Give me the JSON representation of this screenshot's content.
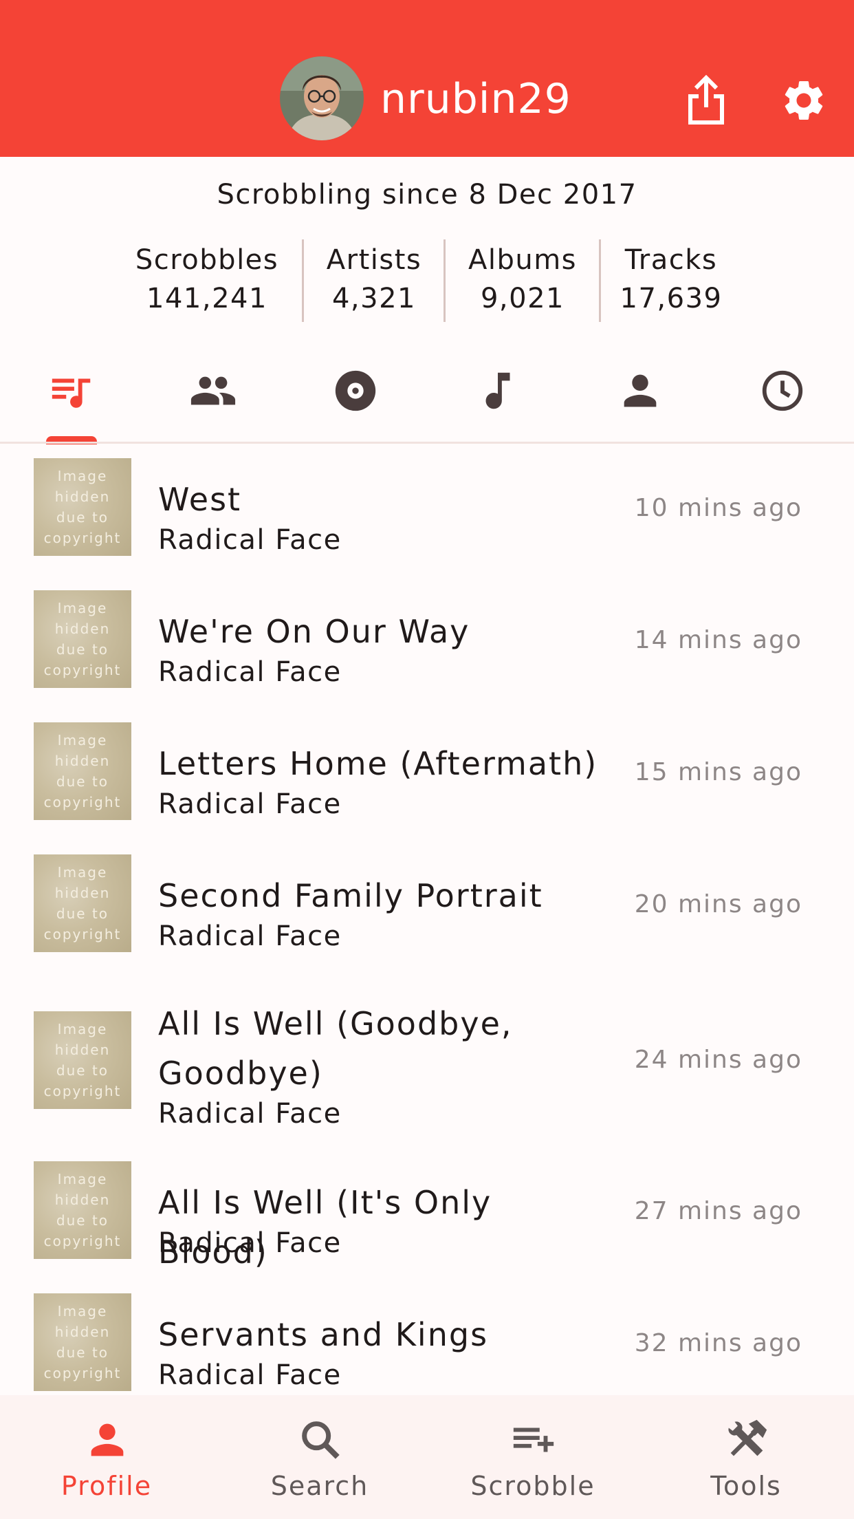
{
  "header": {
    "username": "nrubin29",
    "background_color": "#f44336",
    "share_icon": "share-icon",
    "settings_icon": "gear-icon"
  },
  "profile": {
    "scrobbling_since": "Scrobbling since 8 Dec 2017",
    "stats": [
      {
        "label": "Scrobbles",
        "value": "141,241"
      },
      {
        "label": "Artists",
        "value": "4,321"
      },
      {
        "label": "Albums",
        "value": "9,021"
      },
      {
        "label": "Tracks",
        "value": "17,639"
      }
    ]
  },
  "tabs": [
    {
      "icon": "recent-scrobbles-icon",
      "selected": true
    },
    {
      "icon": "friends-icon",
      "selected": false
    },
    {
      "icon": "album-icon",
      "selected": false
    },
    {
      "icon": "track-icon",
      "selected": false
    },
    {
      "icon": "artist-icon",
      "selected": false
    },
    {
      "icon": "clock-icon",
      "selected": false
    }
  ],
  "placeholder_image_text": "Image\nhidden\ndue to\ncopyright",
  "scrobbles": [
    {
      "title": "West",
      "artist": "Radical Face",
      "time": "10 mins ago"
    },
    {
      "title": "We're On Our Way",
      "artist": "Radical Face",
      "time": "14 mins ago"
    },
    {
      "title": "Letters Home (Aftermath)",
      "artist": "Radical Face",
      "time": "15 mins ago"
    },
    {
      "title": "Second Family Portrait",
      "artist": "Radical Face",
      "time": "20 mins ago"
    },
    {
      "title": "All Is Well (Goodbye, Goodbye)",
      "artist": "Radical Face",
      "time": "24 mins ago"
    },
    {
      "title": "All Is Well (It's Only Blood)",
      "artist": "Radical Face",
      "time": "27 mins ago"
    },
    {
      "title": "Servants and Kings",
      "artist": "Radical Face",
      "time": "32 mins ago"
    }
  ],
  "bottom_nav": {
    "active_color": "#f44336",
    "items": [
      {
        "label": "Profile",
        "icon": "person-icon",
        "active": true
      },
      {
        "label": "Search",
        "icon": "search-icon",
        "active": false
      },
      {
        "label": "Scrobble",
        "icon": "playlist-add-icon",
        "active": false
      },
      {
        "label": "Tools",
        "icon": "tools-icon",
        "active": false
      }
    ]
  }
}
